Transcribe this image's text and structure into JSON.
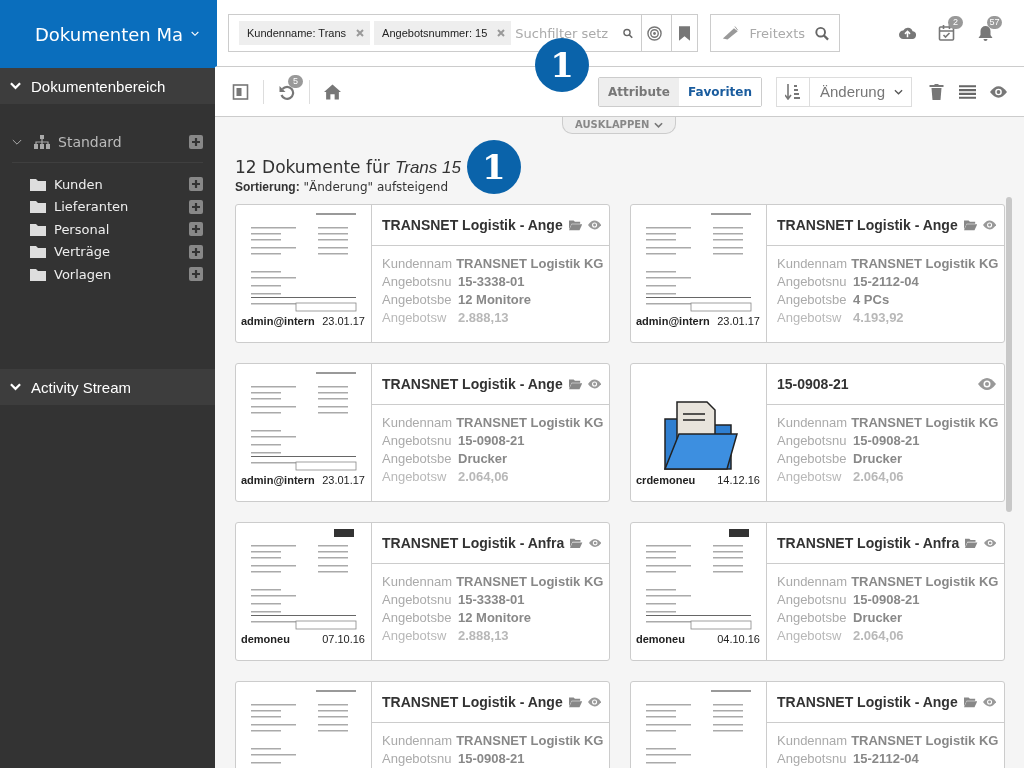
{
  "header": {
    "title": "Dokumenten Ma"
  },
  "search": {
    "chips": [
      {
        "label": "Kundenname: Trans"
      },
      {
        "label": "Angebotsnummer: 15"
      }
    ],
    "placeholder": "Suchfilter setz",
    "freitext_placeholder": "Freitexts"
  },
  "top_icons": {
    "calendar_count": "2",
    "bell_count": "57"
  },
  "toolbar": {
    "undo_count": "5",
    "view_tabs": [
      {
        "label": "Attribute",
        "selected": true
      },
      {
        "label": "Favoriten",
        "selected": false
      }
    ],
    "sort": "Änderung"
  },
  "expand_tab": "AUSKLAPPEN",
  "markers": [
    {
      "label": "1"
    },
    {
      "label": "1"
    }
  ],
  "sidebar": {
    "sections": [
      {
        "title": "Dokumentenbereich",
        "expanded": true,
        "tree": [
          {
            "label": "Standard",
            "expanded": true,
            "children": [
              {
                "label": "Kunden"
              },
              {
                "label": "Lieferanten"
              },
              {
                "label": "Personal"
              },
              {
                "label": "Verträge"
              },
              {
                "label": "Vorlagen"
              }
            ]
          }
        ]
      },
      {
        "title": "Activity Stream",
        "expanded": true
      }
    ]
  },
  "result": {
    "heading": "12 Dokumente für *Trans 15*",
    "sorting": "**Sortierung:** \"Änderung\" aufsteigend"
  },
  "cards": [
    {
      "title": "TRANSNET Logistik - Ange",
      "folder": true,
      "thumb": {
        "kind": "letter"
      },
      "user": "admin@intern",
      "date": "23.01.17",
      "fields": [
        {
          "label": "Kundennam",
          "value": "TRANSNET Logistik KG"
        },
        {
          "label": "Angebotsnu",
          "value": "15-3338-01"
        },
        {
          "label": "Angebotsbe",
          "value": "12 Monitore"
        },
        {
          "label": "Angebotsw",
          "value": "2.888,13"
        }
      ]
    },
    {
      "title": "TRANSNET Logistik - Ange",
      "folder": true,
      "thumb": {
        "kind": "letter"
      },
      "user": "admin@intern",
      "date": "23.01.17",
      "fields": [
        {
          "label": "Kundennam",
          "value": "TRANSNET Logistik KG"
        },
        {
          "label": "Angebotsnu",
          "value": "15-2112-04"
        },
        {
          "label": "Angebotsbe",
          "value": "4 PCs"
        },
        {
          "label": "Angebotsw",
          "value": "4.193,92"
        }
      ]
    },
    {
      "title": "TRANSNET Logistik - Ange",
      "folder": true,
      "thumb": {
        "kind": "letter"
      },
      "user": "admin@intern",
      "date": "23.01.17",
      "fields": [
        {
          "label": "Kundennam",
          "value": "TRANSNET Logistik KG"
        },
        {
          "label": "Angebotsnu",
          "value": "15-0908-21"
        },
        {
          "label": "Angebotsbe",
          "value": "Drucker"
        },
        {
          "label": "Angebotsw",
          "value": "2.064,06"
        }
      ]
    },
    {
      "title": "15-0908-21",
      "folder": false,
      "thumb": {
        "kind": "folder"
      },
      "user": "crdemoneu",
      "date": "14.12.16",
      "fields": [
        {
          "label": "Kundennam",
          "value": "TRANSNET Logistik KG"
        },
        {
          "label": "Angebotsnu",
          "value": "15-0908-21"
        },
        {
          "label": "Angebotsbe",
          "value": "Drucker"
        },
        {
          "label": "Angebotsw",
          "value": "2.064,06"
        }
      ]
    },
    {
      "title": "TRANSNET Logistik - Anfra",
      "folder": true,
      "thumb": {
        "kind": "truck-letter"
      },
      "user": "demoneu",
      "date": "07.10.16",
      "fields": [
        {
          "label": "Kundennam",
          "value": "TRANSNET Logistik KG"
        },
        {
          "label": "Angebotsnu",
          "value": "15-3338-01"
        },
        {
          "label": "Angebotsbe",
          "value": "12 Monitore"
        },
        {
          "label": "Angebotsw",
          "value": "2.888,13"
        }
      ]
    },
    {
      "title": "TRANSNET Logistik - Anfra",
      "folder": true,
      "thumb": {
        "kind": "truck-letter"
      },
      "user": "demoneu",
      "date": "04.10.16",
      "fields": [
        {
          "label": "Kundennam",
          "value": "TRANSNET Logistik KG"
        },
        {
          "label": "Angebotsnu",
          "value": "15-0908-21"
        },
        {
          "label": "Angebotsbe",
          "value": "Drucker"
        },
        {
          "label": "Angebotsw",
          "value": "2.064,06"
        }
      ]
    },
    {
      "title": "TRANSNET Logistik - Ange",
      "folder": true,
      "thumb": {
        "kind": "letter"
      },
      "fields": [
        {
          "label": "Kundennam",
          "value": "TRANSNET Logistik KG"
        },
        {
          "label": "Angebotsnu",
          "value": "15-0908-21"
        }
      ]
    },
    {
      "title": "TRANSNET Logistik - Ange",
      "folder": true,
      "thumb": {
        "kind": "letter"
      },
      "fields": [
        {
          "label": "Kundennam",
          "value": "TRANSNET Logistik KG"
        },
        {
          "label": "Angebotsnu",
          "value": "15-2112-04"
        }
      ]
    }
  ]
}
